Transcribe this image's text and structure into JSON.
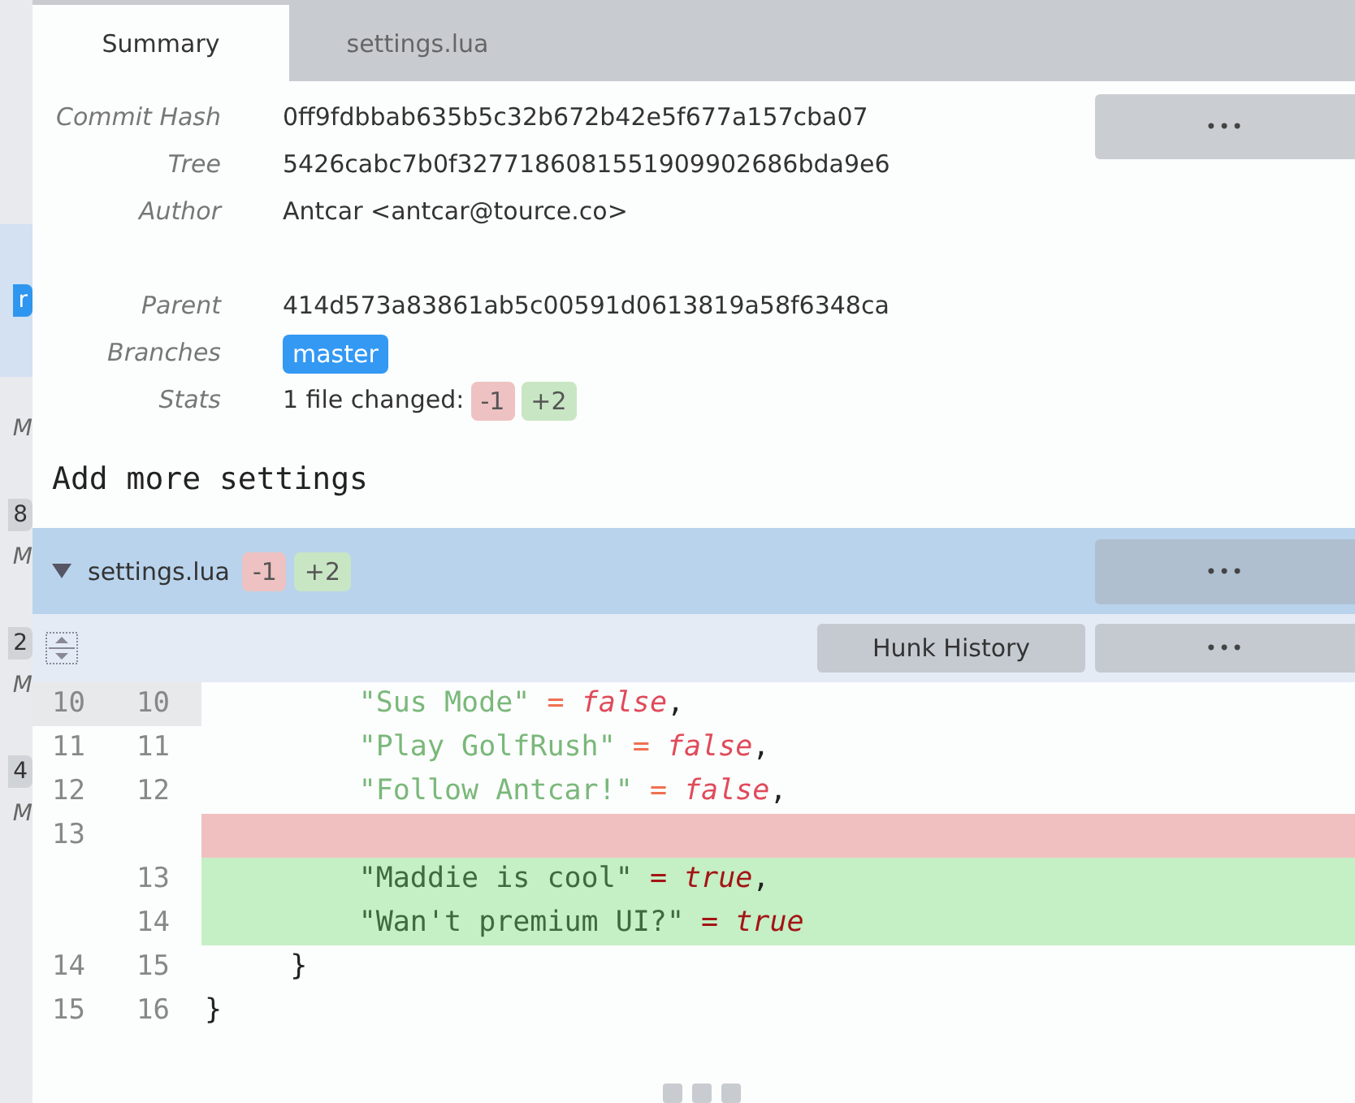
{
  "left_panel": {
    "items": [
      {
        "badge": "r",
        "selected": true
      },
      {
        "text": "M",
        "selected": false
      },
      {
        "badge": "8",
        "text": "M",
        "selected": false
      },
      {
        "badge": "2",
        "text": "M",
        "selected": false
      },
      {
        "badge": "4",
        "text": "M",
        "selected": false
      }
    ]
  },
  "tabs": [
    {
      "label": "Summary",
      "selected": true
    },
    {
      "label": "settings.lua",
      "selected": false
    }
  ],
  "summary": {
    "fields": [
      {
        "kind": "text",
        "label": "Commit Hash",
        "value": "0ff9fdbbab635b5c32b672b42e5f677a157cba07"
      },
      {
        "kind": "text",
        "label": "Tree",
        "value": "5426cabc7b0f3277186081551909902686bda9e6"
      },
      {
        "kind": "text",
        "label": "Author",
        "value": "Antcar <antcar@tource.co>"
      },
      {
        "kind": "spacer"
      },
      {
        "kind": "text",
        "label": "Parent",
        "value": "414d573a83861ab5c00591d0613819a58f6348ca"
      },
      {
        "kind": "branch",
        "label": "Branches",
        "value": "master"
      },
      {
        "kind": "stats",
        "label": "Stats",
        "value": "1 file changed:",
        "removed": "-1",
        "added": "+2"
      }
    ],
    "more_button": "•••"
  },
  "commit_message": "Add more settings",
  "file": {
    "name": "settings.lua",
    "removed": "-1",
    "added": "+2",
    "expanded": true,
    "more_button": "•••",
    "hunk": {
      "history_button": "Hunk History",
      "more_button": "•••",
      "lines": [
        {
          "kind": "context",
          "old": "10",
          "new": "10",
          "selected": true,
          "segments": [
            {
              "kind": "string",
              "text": "         \"Sus Mode\""
            },
            {
              "kind": "op",
              "text": " = "
            },
            {
              "kind": "false",
              "text": "false"
            },
            {
              "kind": "plain",
              "text": ","
            }
          ]
        },
        {
          "kind": "context",
          "old": "11",
          "new": "11",
          "selected": false,
          "segments": [
            {
              "kind": "string",
              "text": "         \"Play GolfRush\""
            },
            {
              "kind": "op",
              "text": " = "
            },
            {
              "kind": "false",
              "text": "false"
            },
            {
              "kind": "plain",
              "text": ","
            }
          ]
        },
        {
          "kind": "context",
          "old": "12",
          "new": "12",
          "selected": false,
          "segments": [
            {
              "kind": "string",
              "text": "         \"Follow Antcar!\""
            },
            {
              "kind": "op",
              "text": " = "
            },
            {
              "kind": "false",
              "text": "false"
            },
            {
              "kind": "plain",
              "text": ","
            }
          ]
        },
        {
          "kind": "removed",
          "old": "13",
          "selected": false
        },
        {
          "kind": "added",
          "new": "13",
          "selected": false,
          "segments": [
            {
              "kind": "string",
              "text": "         \"Maddie is cool\""
            },
            {
              "kind": "op",
              "text": " = "
            },
            {
              "kind": "true",
              "text": "true"
            },
            {
              "kind": "plain",
              "text": ","
            }
          ]
        },
        {
          "kind": "added",
          "new": "14",
          "selected": false,
          "segments": [
            {
              "kind": "string",
              "text": "         \"Wan't premium UI?\""
            },
            {
              "kind": "op",
              "text": " = "
            },
            {
              "kind": "true",
              "text": "true"
            }
          ]
        },
        {
          "kind": "context",
          "old": "14",
          "new": "15",
          "selected": false,
          "segments": [
            {
              "kind": "plain",
              "text": "     }"
            }
          ]
        },
        {
          "kind": "context",
          "old": "15",
          "new": "16",
          "selected": false,
          "segments": [
            {
              "kind": "plain",
              "text": "}"
            }
          ]
        }
      ]
    }
  }
}
